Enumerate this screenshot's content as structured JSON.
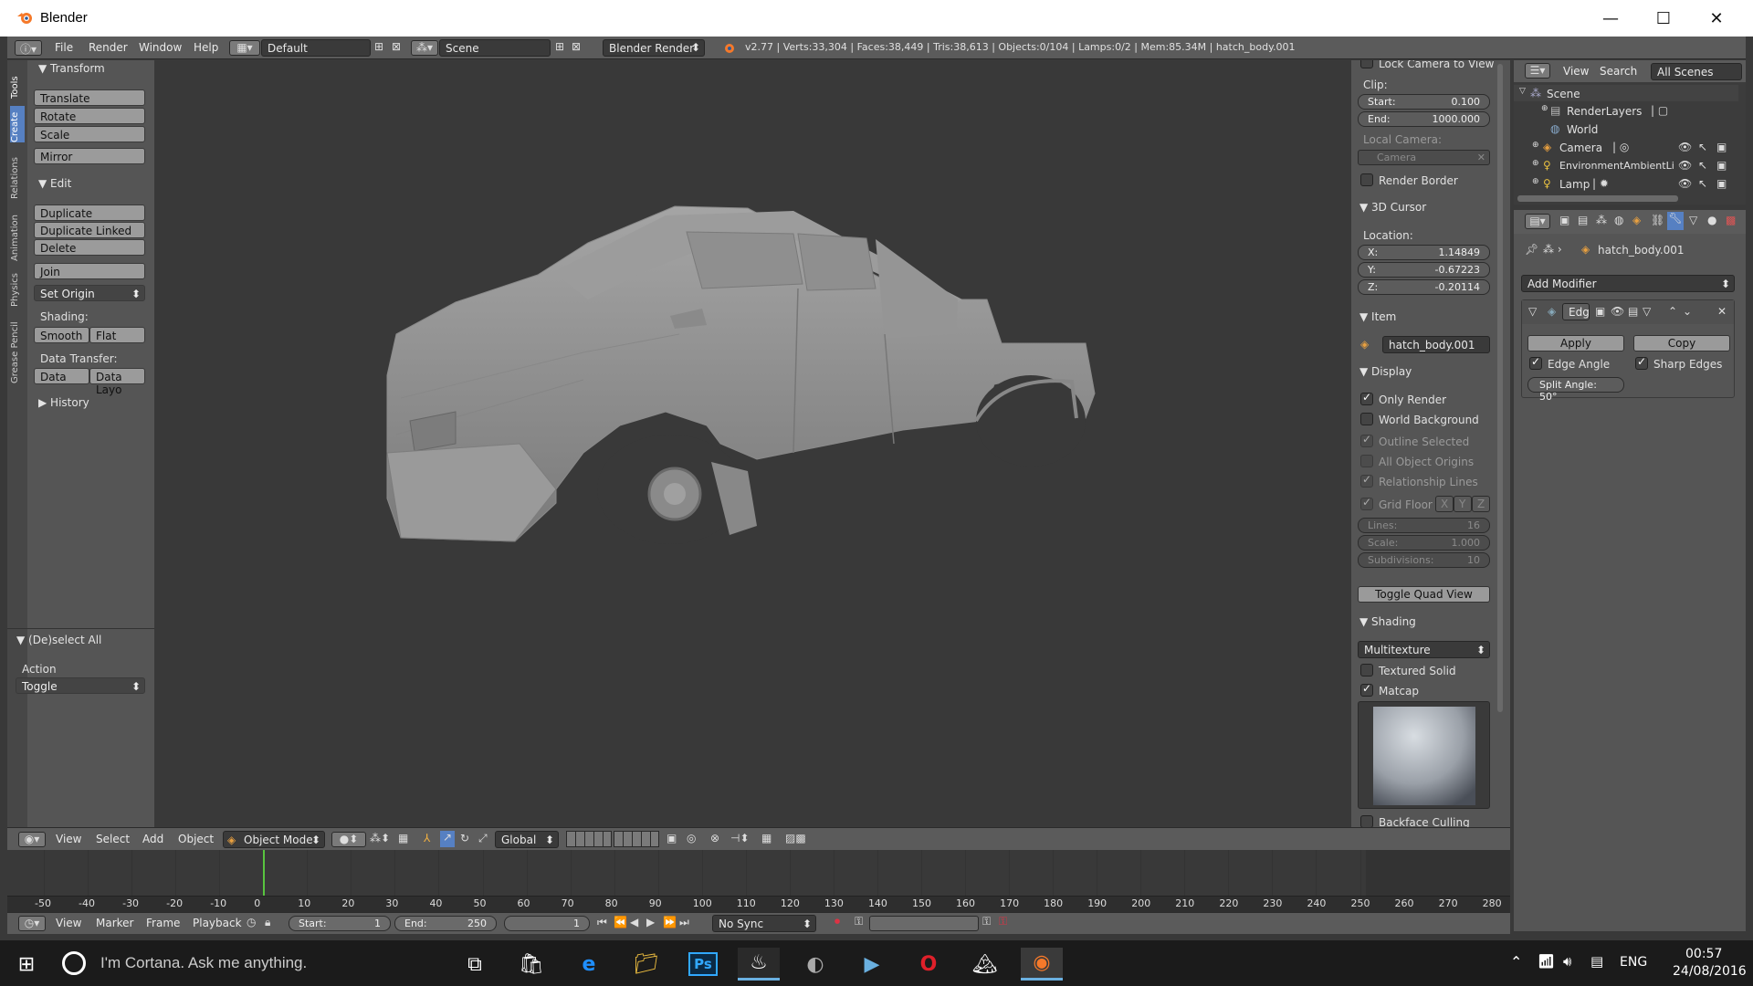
{
  "window": {
    "title": "Blender",
    "minimize": "—",
    "maximize": "☐",
    "close": "✕"
  },
  "info_header": {
    "menus": [
      "File",
      "Render",
      "Window",
      "Help"
    ],
    "screen_layout": "Default",
    "scene": "Scene",
    "render_engine": "Blender Render",
    "stats": "v2.77 | Verts:33,304 | Faces:38,449 | Tris:38,613 | Objects:0/104 | Lamps:0/2 | Mem:85.34M | hatch_body.001"
  },
  "tool_tabs": [
    "Tools",
    "Create",
    "Relations",
    "Animation",
    "Physics",
    "Grease Pencil"
  ],
  "tool_shelf": {
    "transform": {
      "title": "Transform",
      "buttons": [
        "Translate",
        "Rotate",
        "Scale",
        "Mirror"
      ]
    },
    "edit": {
      "title": "Edit",
      "buttons": [
        "Duplicate",
        "Duplicate Linked",
        "Delete",
        "Join"
      ],
      "set_origin": "Set Origin"
    },
    "shading": {
      "label": "Shading:",
      "smooth": "Smooth",
      "flat": "Flat"
    },
    "data_transfer": {
      "label": "Data Transfer:",
      "data": "Data",
      "data_layout": "Data Layo"
    },
    "history": {
      "title": "History"
    }
  },
  "operator_panel": {
    "title": "(De)select All",
    "action_label": "Action",
    "action_value": "Toggle"
  },
  "n_panel": {
    "lock_camera": "Lock Camera to View",
    "clip_label": "Clip:",
    "clip_start": {
      "k": "Start:",
      "v": "0.100"
    },
    "clip_end": {
      "k": "End:",
      "v": "1000.000"
    },
    "local_camera_label": "Local Camera:",
    "local_camera_value": "Camera",
    "render_border": "Render Border",
    "cursor_title": "3D Cursor",
    "location_label": "Location:",
    "cx": {
      "k": "X:",
      "v": "1.14849"
    },
    "cy": {
      "k": "Y:",
      "v": "-0.67223"
    },
    "cz": {
      "k": "Z:",
      "v": "-0.20114"
    },
    "item_title": "Item",
    "item_name": "hatch_body.001",
    "display_title": "Display",
    "only_render": "Only Render",
    "world_background": "World Background",
    "outline_selected": "Outline Selected",
    "all_object_origins": "All Object Origins",
    "relationship_lines": "Relationship Lines",
    "grid_floor": "Grid Floor",
    "axes": [
      "X",
      "Y",
      "Z"
    ],
    "lines": {
      "k": "Lines:",
      "v": "16"
    },
    "scale": {
      "k": "Scale:",
      "v": "1.000"
    },
    "subdivisions": {
      "k": "Subdivisions:",
      "v": "10"
    },
    "toggle_quad": "Toggle Quad View",
    "shading_title": "Shading",
    "shading_mode": "Multitexture",
    "textured_solid": "Textured Solid",
    "matcap": "Matcap",
    "backface_culling": "Backface Culling"
  },
  "view_header": {
    "menus": [
      "View",
      "Select",
      "Add",
      "Object"
    ],
    "mode": "Object Mode",
    "orientation": "Global"
  },
  "timeline": {
    "ticks": [
      "-50",
      "-40",
      "-30",
      "-20",
      "-10",
      "0",
      "10",
      "20",
      "30",
      "40",
      "50",
      "60",
      "70",
      "80",
      "90",
      "100",
      "110",
      "120",
      "130",
      "140",
      "150",
      "160",
      "170",
      "180",
      "190",
      "200",
      "210",
      "220",
      "230",
      "240",
      "250",
      "260",
      "270",
      "280"
    ],
    "current_frame_value": 0,
    "menus": [
      "View",
      "Marker",
      "Frame",
      "Playback"
    ],
    "start": {
      "k": "Start:",
      "v": "1"
    },
    "end": {
      "k": "End:",
      "v": "250"
    },
    "current": "1",
    "sync": "No Sync"
  },
  "outliner": {
    "menus": [
      "View",
      "Search"
    ],
    "filter": "All Scenes",
    "items": [
      "Scene",
      "RenderLayers",
      "World",
      "Camera",
      "EnvironmentAmbientLi",
      "Lamp"
    ]
  },
  "properties": {
    "object_name": "hatch_body.001",
    "add_modifier": "Add Modifier",
    "modifier_name": "Edg",
    "apply": "Apply",
    "copy": "Copy",
    "edge_angle": "Edge Angle",
    "sharp_edges": "Sharp Edges",
    "split_angle": "Split Angle: 50°"
  },
  "taskbar": {
    "cortana": "I'm Cortana. Ask me anything.",
    "lang": "ENG",
    "time": "00:57",
    "date": "24/08/2016"
  },
  "colors": {
    "accent": "#5680c2",
    "timeline_cursor": "#58c43f",
    "viewport_bg": "#393939",
    "panel_bg": "#555555"
  }
}
